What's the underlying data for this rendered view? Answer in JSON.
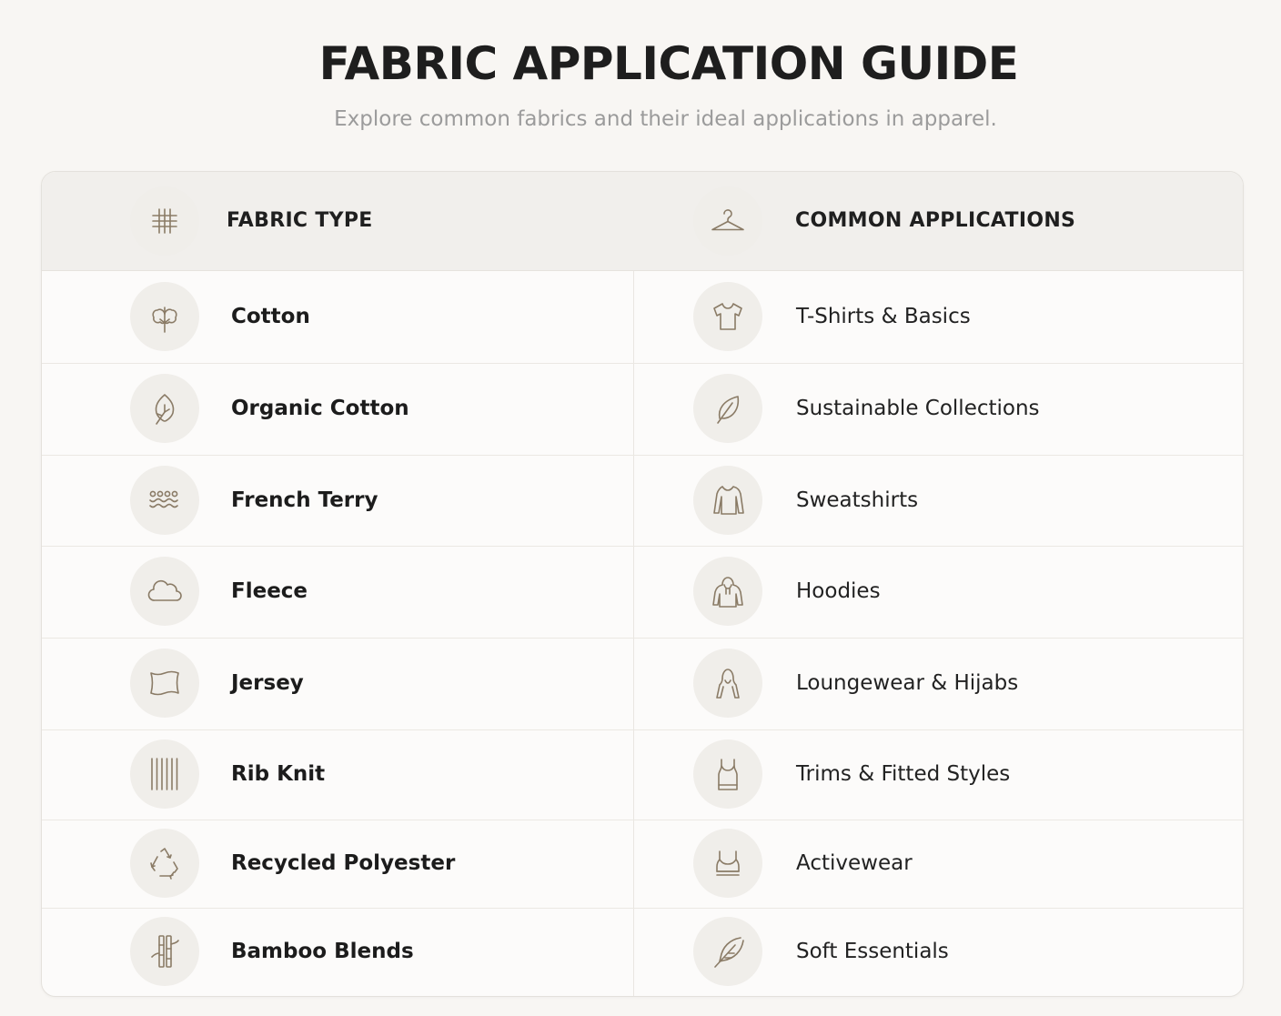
{
  "header": {
    "title": "FABRIC APPLICATION GUIDE",
    "subtitle": "Explore common fabrics and their ideal applications in apparel."
  },
  "table": {
    "columns": [
      {
        "label": "FABRIC TYPE",
        "icon": "fabric-grid-icon"
      },
      {
        "label": "COMMON APPLICATIONS",
        "icon": "hanger-icon"
      }
    ],
    "rows": [
      {
        "fabric": "Cotton",
        "fabric_icon": "cotton-plant-icon",
        "application": "T-Shirts & Basics",
        "application_icon": "tshirt-icon"
      },
      {
        "fabric": "Organic Cotton",
        "fabric_icon": "leaf-circle-icon",
        "application": "Sustainable Collections",
        "application_icon": "leaf-icon"
      },
      {
        "fabric": "French Terry",
        "fabric_icon": "terry-loops-icon",
        "application": "Sweatshirts",
        "application_icon": "sweatshirt-icon"
      },
      {
        "fabric": "Fleece",
        "fabric_icon": "cloud-icon",
        "application": "Hoodies",
        "application_icon": "hoodie-icon"
      },
      {
        "fabric": "Jersey",
        "fabric_icon": "fabric-swatch-icon",
        "application": "Loungewear & Hijabs",
        "application_icon": "hijab-icon"
      },
      {
        "fabric": "Rib Knit",
        "fabric_icon": "vertical-ribs-icon",
        "application": "Trims & Fitted Styles",
        "application_icon": "tank-top-icon"
      },
      {
        "fabric": "Recycled Polyester",
        "fabric_icon": "recycle-icon",
        "application": "Activewear",
        "application_icon": "sports-bra-icon"
      },
      {
        "fabric": "Bamboo Blends",
        "fabric_icon": "bamboo-icon",
        "application": "Soft Essentials",
        "application_icon": "feather-icon"
      }
    ]
  },
  "colors": {
    "background": "#f8f6f3",
    "header_row": "#f1efec",
    "icon_stroke": "#8a7b66",
    "icon_circle": "#f0eeea",
    "subtitle": "#9b9b9b"
  }
}
